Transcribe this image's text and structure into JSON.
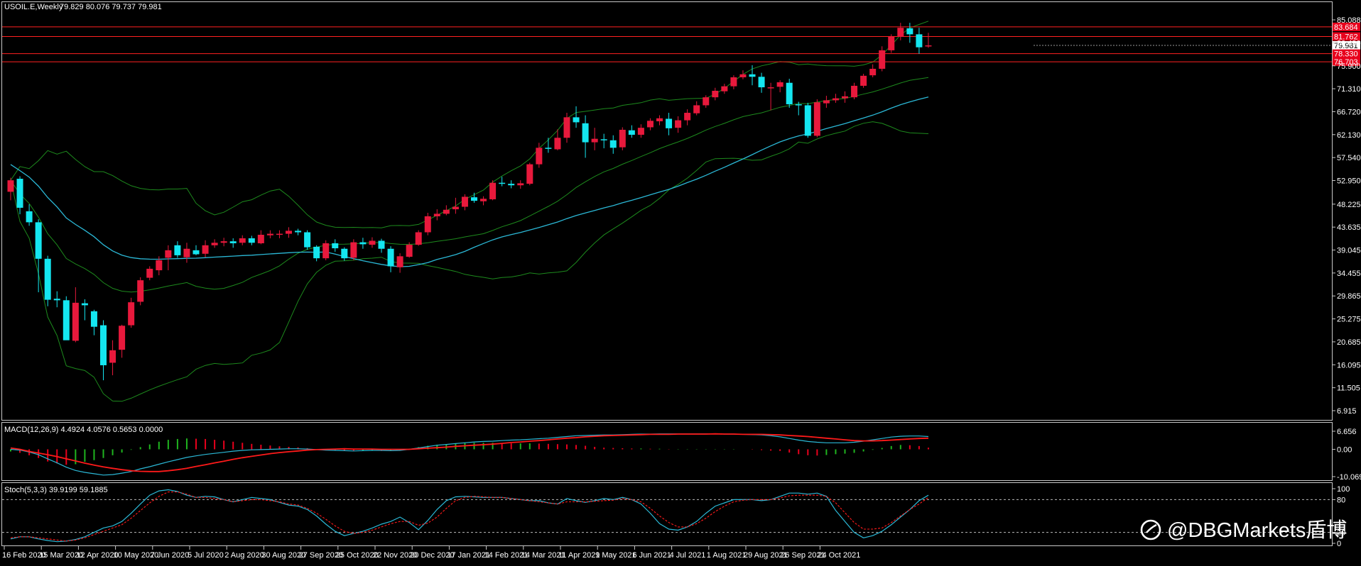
{
  "chart_data": [
    {
      "type": "candlestick",
      "title": "USOIL.E,Weekly",
      "ohlc_header": "79.829 80.076 79.737 79.981",
      "ylim": [
        6.915,
        85.088
      ],
      "y_ticks": [
        "85.088",
        "80.490",
        "75.900",
        "71.310",
        "66.720",
        "62.130",
        "57.540",
        "52.950",
        "48.225",
        "43.635",
        "39.045",
        "34.455",
        "29.865",
        "25.275",
        "20.685",
        "16.095",
        "11.505",
        "6.915"
      ],
      "price_levels": [
        {
          "value": 83.684,
          "label": "83.684"
        },
        {
          "value": 81.762,
          "label": "81.762"
        },
        {
          "value": 79.981,
          "label": "79.981",
          "current": true
        },
        {
          "value": 78.33,
          "label": "78.330"
        },
        {
          "value": 76.703,
          "label": "76.703"
        }
      ],
      "x_labels": [
        "16 Feb 2020",
        "15 Mar 2020",
        "12 Apr 2020",
        "10 May 2020",
        "7 Jun 2020",
        "5 Jul 2020",
        "2 Aug 2020",
        "30 Aug 2020",
        "27 Sep 2020",
        "25 Oct 2020",
        "22 Nov 2020",
        "20 Dec 2020",
        "17 Jan 2021",
        "14 Feb 2021",
        "14 Mar 2021",
        "11 Apr 2021",
        "9 May 2021",
        "6 Jun 2021",
        "4 Jul 2021",
        "1 Aug 2021",
        "29 Aug 2021",
        "26 Sep 2021",
        "24 Oct 2021"
      ],
      "candles": [
        [
          50.7,
          53.0,
          49.0,
          53.5
        ],
        [
          53.3,
          47.5,
          46.2,
          53.8
        ],
        [
          46.8,
          44.6,
          43.9,
          48.2
        ],
        [
          44.6,
          37.3,
          30.6,
          45.2
        ],
        [
          37.3,
          29.1,
          27.8,
          37.9
        ],
        [
          29.3,
          29.0,
          27.6,
          30.8
        ],
        [
          29.0,
          21.0,
          21.5,
          29.8
        ],
        [
          20.9,
          28.5,
          20.6,
          31.6
        ],
        [
          28.4,
          28.0,
          25.0,
          29.2
        ],
        [
          26.8,
          23.7,
          22.0,
          27.1
        ],
        [
          24.0,
          16.0,
          13.0,
          25.0
        ],
        [
          16.5,
          19.0,
          14.0,
          21.0
        ],
        [
          19.1,
          23.9,
          17.5,
          24.1
        ],
        [
          24.0,
          28.6,
          23.5,
          29.5
        ],
        [
          28.7,
          33.0,
          28.0,
          33.6
        ],
        [
          33.5,
          35.3,
          33.0,
          35.8
        ],
        [
          35.0,
          37.0,
          34.0,
          37.8
        ],
        [
          37.5,
          39.0,
          35.0,
          40.0
        ],
        [
          40.0,
          38.0,
          37.5,
          40.8
        ],
        [
          37.6,
          39.3,
          36.5,
          40.5
        ],
        [
          39.0,
          38.2,
          38.0,
          40.0
        ],
        [
          38.3,
          40.0,
          37.6,
          41.0
        ],
        [
          40.0,
          40.5,
          39.5,
          41.2
        ],
        [
          40.5,
          40.8,
          39.8,
          41.5
        ],
        [
          40.8,
          40.4,
          39.5,
          41.4
        ],
        [
          40.5,
          41.4,
          40.0,
          42.0
        ],
        [
          41.4,
          40.5,
          40.0,
          41.9
        ],
        [
          40.4,
          42.1,
          40.2,
          43.0
        ],
        [
          42.0,
          42.3,
          41.4,
          43.0
        ],
        [
          42.3,
          42.3,
          41.4,
          43.0
        ],
        [
          42.3,
          42.9,
          41.5,
          43.6
        ],
        [
          42.9,
          42.6,
          42.0,
          43.3
        ],
        [
          42.6,
          39.6,
          39.1,
          43.0
        ],
        [
          39.7,
          37.4,
          36.8,
          40.0
        ],
        [
          37.4,
          40.4,
          37.0,
          41.0
        ],
        [
          40.4,
          39.4,
          38.7,
          41.2
        ],
        [
          39.3,
          37.4,
          36.9,
          39.6
        ],
        [
          37.5,
          40.6,
          37.0,
          41.2
        ],
        [
          40.6,
          40.2,
          39.3,
          41.5
        ],
        [
          40.1,
          40.9,
          39.5,
          41.6
        ],
        [
          40.9,
          39.3,
          38.5,
          41.3
        ],
        [
          39.3,
          35.8,
          34.6,
          39.8
        ],
        [
          35.6,
          37.8,
          34.5,
          38.4
        ],
        [
          37.7,
          40.1,
          37.5,
          40.6
        ],
        [
          40.1,
          42.6,
          39.9,
          43.0
        ],
        [
          42.6,
          45.8,
          42.0,
          46.5
        ],
        [
          45.8,
          46.3,
          45.0,
          47.2
        ],
        [
          46.3,
          47.1,
          46.0,
          48.0
        ],
        [
          47.2,
          47.7,
          46.3,
          49.5
        ],
        [
          47.7,
          49.7,
          47.0,
          50.2
        ],
        [
          49.6,
          48.9,
          48.5,
          50.5
        ],
        [
          48.8,
          49.3,
          48.0,
          49.8
        ],
        [
          49.2,
          52.5,
          49.0,
          53.0
        ],
        [
          52.5,
          52.3,
          51.8,
          53.7
        ],
        [
          52.3,
          52.0,
          51.4,
          53.0
        ],
        [
          52.0,
          52.4,
          51.3,
          53.0
        ],
        [
          52.3,
          56.2,
          52.0,
          56.5
        ],
        [
          56.2,
          59.5,
          55.5,
          60.5
        ],
        [
          59.5,
          59.3,
          58.5,
          61.5
        ],
        [
          59.2,
          61.5,
          59.0,
          63.2
        ],
        [
          61.5,
          65.6,
          60.5,
          66.5
        ],
        [
          65.6,
          64.6,
          63.5,
          67.8
        ],
        [
          64.4,
          60.6,
          57.5,
          66.0
        ],
        [
          60.6,
          61.3,
          59.0,
          63.5
        ],
        [
          61.2,
          61.1,
          59.4,
          62.3
        ],
        [
          61.0,
          59.5,
          58.3,
          62.0
        ],
        [
          59.6,
          63.1,
          59.0,
          63.6
        ],
        [
          63.0,
          62.1,
          61.5,
          64.0
        ],
        [
          62.1,
          63.5,
          61.5,
          64.2
        ],
        [
          63.6,
          64.9,
          63.0,
          65.4
        ],
        [
          64.8,
          65.4,
          64.0,
          66.0
        ],
        [
          65.3,
          63.4,
          62.0,
          66.5
        ],
        [
          63.5,
          65.0,
          62.5,
          65.8
        ],
        [
          65.0,
          66.5,
          64.0,
          67.2
        ],
        [
          66.4,
          68.0,
          66.0,
          68.8
        ],
        [
          68.0,
          69.6,
          67.5,
          70.0
        ],
        [
          69.6,
          70.9,
          69.0,
          71.5
        ],
        [
          70.8,
          71.8,
          70.3,
          72.3
        ],
        [
          71.8,
          73.6,
          71.2,
          74.0
        ],
        [
          73.6,
          74.2,
          73.2,
          75.0
        ],
        [
          74.2,
          73.7,
          72.0,
          76.0
        ],
        [
          73.7,
          71.6,
          70.5,
          74.5
        ],
        [
          71.6,
          71.6,
          67.0,
          72.5
        ],
        [
          71.7,
          72.6,
          70.6,
          73.0
        ],
        [
          72.5,
          68.2,
          67.5,
          73.3
        ],
        [
          68.2,
          68.0,
          66.0,
          68.7
        ],
        [
          68.0,
          61.9,
          61.5,
          68.5
        ],
        [
          61.9,
          68.6,
          61.6,
          69.2
        ],
        [
          68.4,
          69.0,
          67.5,
          69.9
        ],
        [
          69.0,
          69.4,
          68.5,
          70.3
        ],
        [
          69.4,
          69.8,
          68.5,
          70.8
        ],
        [
          69.6,
          71.9,
          69.2,
          72.5
        ],
        [
          71.9,
          73.9,
          71.5,
          74.3
        ],
        [
          74.0,
          75.3,
          73.6,
          76.2
        ],
        [
          75.3,
          79.0,
          74.8,
          79.8
        ],
        [
          79.0,
          81.7,
          78.5,
          82.2
        ],
        [
          81.7,
          83.5,
          81.0,
          84.5
        ],
        [
          83.4,
          82.2,
          80.5,
          84.5
        ],
        [
          82.2,
          79.6,
          78.3,
          83.5
        ],
        [
          79.8,
          79.98,
          79.5,
          82.5
        ]
      ],
      "indicators": [
        "Bollinger Bands",
        "Moving Average"
      ]
    },
    {
      "type": "macd",
      "label": "MACD(12,26,9) 4.4924 4.0576 0.5653 0.0000",
      "ylim": [
        -10.0699,
        6.656
      ],
      "y_ticks": [
        "6.656",
        "0.00",
        "-10.0699"
      ],
      "hist": [
        -0.8,
        -1.3,
        -2.2,
        -3.2,
        -4.5,
        -5.2,
        -5.7,
        -5.5,
        -4.6,
        -4.0,
        -3.2,
        -2.2,
        -1.2,
        -0.2,
        0.8,
        1.8,
        2.8,
        3.5,
        3.8,
        4.0,
        3.9,
        3.8,
        3.5,
        3.2,
        2.8,
        2.4,
        2.0,
        1.7,
        1.4,
        1.1,
        0.9,
        0.7,
        0.4,
        0.0,
        -0.2,
        -0.3,
        -0.4,
        -0.5,
        -0.5,
        -0.5,
        -0.6,
        -0.5,
        -0.3,
        0.2,
        0.8,
        1.3,
        1.7,
        1.9,
        2.1,
        2.3,
        2.4,
        2.4,
        2.4,
        2.3,
        2.2,
        2.2,
        2.2,
        2.1,
        2.0,
        1.9,
        1.8,
        1.6,
        1.3,
        0.9,
        0.6,
        0.5,
        0.4,
        0.3,
        0.3,
        0.2,
        0.2,
        0.1,
        0.1,
        0.1,
        0.1,
        0.1,
        0.1,
        0.1,
        0.1,
        0.0,
        -0.1,
        -0.3,
        -0.5,
        -0.6,
        -1.2,
        -1.8,
        -2.2,
        -2.3,
        -2.1,
        -1.8,
        -1.6,
        -1.3,
        -0.8,
        -0.2,
        0.5,
        1.2,
        1.6,
        1.5,
        1.2,
        0.6
      ],
      "series": [
        {
          "values": [
            0.0,
            -0.3,
            -1.0,
            -2.0,
            -3.5,
            -5.0,
            -6.6,
            -7.8,
            -8.5,
            -9.0,
            -9.5,
            -9.3,
            -8.8,
            -8.2,
            -7.2,
            -6.4,
            -5.5,
            -4.6,
            -3.8,
            -3.0,
            -2.4,
            -1.9,
            -1.5,
            -1.1,
            -0.7,
            -0.4,
            -0.2,
            -0.1,
            0.0,
            0.1,
            0.2,
            0.2,
            0.1,
            -0.1,
            -0.3,
            -0.4,
            -0.5,
            -0.6,
            -0.5,
            -0.4,
            -0.4,
            -0.5,
            -0.4,
            0.0,
            0.5,
            1.0,
            1.5,
            1.8,
            2.1,
            2.4,
            2.7,
            2.9,
            3.0,
            3.2,
            3.4,
            3.5,
            3.7,
            3.9,
            4.1,
            4.4,
            4.7,
            5.0,
            5.1,
            5.2,
            5.3,
            5.3,
            5.4,
            5.5,
            5.6,
            5.6,
            5.7,
            5.7,
            5.7,
            5.7,
            5.7,
            5.7,
            5.7,
            5.6,
            5.6,
            5.5,
            5.4,
            5.3,
            5.0,
            4.6,
            4.0,
            3.4,
            2.9,
            2.6,
            2.4,
            2.4,
            2.4,
            2.6,
            3.0,
            3.5,
            4.0,
            4.5,
            4.8,
            4.9,
            4.9,
            4.7
          ]
        },
        {
          "values": [
            0.5,
            0.0,
            -0.8,
            -1.4,
            -2.0,
            -2.7,
            -3.5,
            -4.3,
            -5.1,
            -5.8,
            -6.5,
            -7.0,
            -7.5,
            -7.9,
            -8.1,
            -8.2,
            -8.2,
            -7.9,
            -7.5,
            -7.0,
            -6.3,
            -5.7,
            -5.0,
            -4.4,
            -3.7,
            -3.1,
            -2.6,
            -2.1,
            -1.6,
            -1.2,
            -0.9,
            -0.6,
            -0.3,
            -0.1,
            0.0,
            0.1,
            0.2,
            0.1,
            0.1,
            0.1,
            0.0,
            0.0,
            0.0,
            0.0,
            0.2,
            0.4,
            0.6,
            0.8,
            1.1,
            1.3,
            1.5,
            1.7,
            1.9,
            2.2,
            2.5,
            2.7,
            3.0,
            3.2,
            3.5,
            3.8,
            4.1,
            4.3,
            4.6,
            4.8,
            5.0,
            5.1,
            5.2,
            5.3,
            5.4,
            5.5,
            5.5,
            5.5,
            5.6,
            5.6,
            5.6,
            5.6,
            5.7,
            5.6,
            5.6,
            5.5,
            5.5,
            5.5,
            5.4,
            5.3,
            5.1,
            4.9,
            4.7,
            4.4,
            4.1,
            3.8,
            3.5,
            3.2,
            3.1,
            3.1,
            3.2,
            3.4,
            3.6,
            3.8,
            4.0,
            4.1
          ]
        }
      ]
    },
    {
      "type": "stochastic",
      "label": "Stoch(5,3,3) 39.9199 59.1885",
      "ylim": [
        0,
        100
      ],
      "y_ticks": [
        "100",
        "80",
        "20",
        "0"
      ],
      "series": [
        {
          "values": [
            8,
            12,
            12,
            8,
            5,
            3,
            4,
            7,
            12,
            20,
            28,
            32,
            40,
            55,
            72,
            88,
            96,
            98,
            95,
            88,
            84,
            86,
            85,
            80,
            76,
            80,
            84,
            82,
            80,
            75,
            70,
            68,
            62,
            50,
            35,
            22,
            14,
            18,
            22,
            28,
            35,
            40,
            48,
            38,
            25,
            42,
            62,
            78,
            85,
            86,
            85,
            84,
            84,
            84,
            82,
            80,
            78,
            78,
            74,
            72,
            82,
            78,
            75,
            78,
            82,
            80,
            84,
            80,
            72,
            55,
            36,
            26,
            24,
            30,
            40,
            55,
            68,
            74,
            80,
            80,
            80,
            78,
            80,
            86,
            92,
            92,
            90,
            92,
            86,
            60,
            40,
            20,
            10,
            14,
            22,
            34,
            48,
            62,
            78,
            88
          ]
        },
        {
          "values": [
            10,
            12,
            12,
            10,
            8,
            6,
            4,
            6,
            10,
            16,
            22,
            28,
            34,
            46,
            60,
            74,
            86,
            94,
            94,
            90,
            84,
            84,
            82,
            80,
            76,
            78,
            80,
            80,
            78,
            76,
            72,
            70,
            64,
            55,
            44,
            32,
            22,
            18,
            20,
            24,
            30,
            36,
            40,
            40,
            33,
            37,
            48,
            64,
            78,
            84,
            86,
            85,
            84,
            84,
            82,
            80,
            78,
            76,
            74,
            72,
            76,
            76,
            76,
            77,
            78,
            79,
            82,
            80,
            76,
            64,
            50,
            38,
            30,
            30,
            36,
            46,
            58,
            68,
            76,
            79,
            80,
            80,
            80,
            83,
            87,
            88,
            88,
            88,
            86,
            74,
            56,
            38,
            26,
            26,
            28,
            38,
            50,
            62,
            72,
            84
          ]
        }
      ]
    }
  ],
  "watermark": "@DBGMarkets盾博"
}
